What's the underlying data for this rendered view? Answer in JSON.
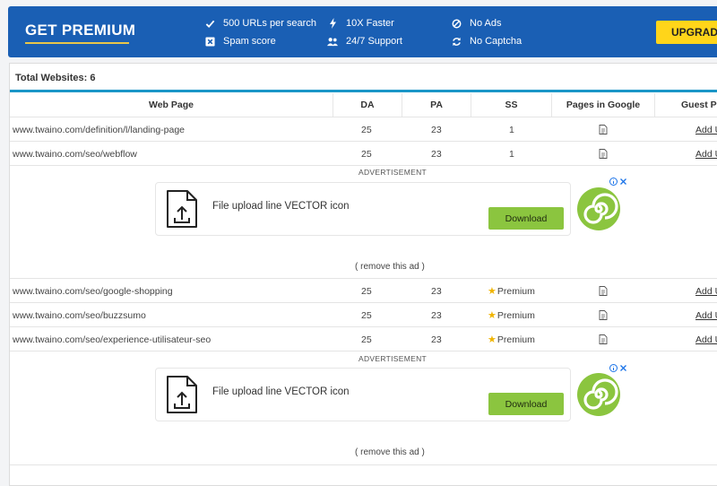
{
  "banner": {
    "title": "GET PREMIUM",
    "features": [
      {
        "label": "500 URLs per search",
        "icon": "check-icon"
      },
      {
        "label": "Spam score",
        "icon": "x-box-icon"
      },
      {
        "label": "10X Faster",
        "icon": "bolt-icon"
      },
      {
        "label": "24/7 Support",
        "icon": "users-icon"
      },
      {
        "label": "No Ads",
        "icon": "ban-icon"
      },
      {
        "label": "No Captcha",
        "icon": "refresh-icon"
      }
    ],
    "upgrade_label": "UPGRADE",
    "accent": "#1a5fb4",
    "button_color": "#ffd51a"
  },
  "table": {
    "total": "Total Websites: 6",
    "headers": [
      "Web Page",
      "DA",
      "PA",
      "SS",
      "Pages in Google",
      "Guest Po"
    ],
    "rows": [
      {
        "url": "www.twaino.com/definition/l/landing-page",
        "da": "25",
        "pa": "23",
        "ss": "1",
        "add": "Add U"
      },
      {
        "url": "www.twaino.com/seo/webflow",
        "da": "25",
        "pa": "23",
        "ss": "1",
        "add": "Add U"
      },
      {
        "url": "www.twaino.com/seo/google-shopping",
        "da": "25",
        "pa": "23",
        "ss": "Premium",
        "add": "Add U"
      },
      {
        "url": "www.twaino.com/seo/buzzsumo",
        "da": "25",
        "pa": "23",
        "ss": "Premium",
        "add": "Add U"
      },
      {
        "url": "www.twaino.com/seo/experience-utilisateur-seo",
        "da": "25",
        "pa": "23",
        "ss": "Premium",
        "add": "Add U"
      }
    ]
  },
  "ads": [
    {
      "label": "ADVERTISEMENT",
      "title": "File upload line VECTOR icon",
      "button": "Download",
      "remove": "( remove this ad )"
    },
    {
      "label": "ADVERTISEMENT",
      "title": "File upload line VECTOR icon",
      "button": "Download",
      "remove": "( remove this ad )"
    }
  ]
}
